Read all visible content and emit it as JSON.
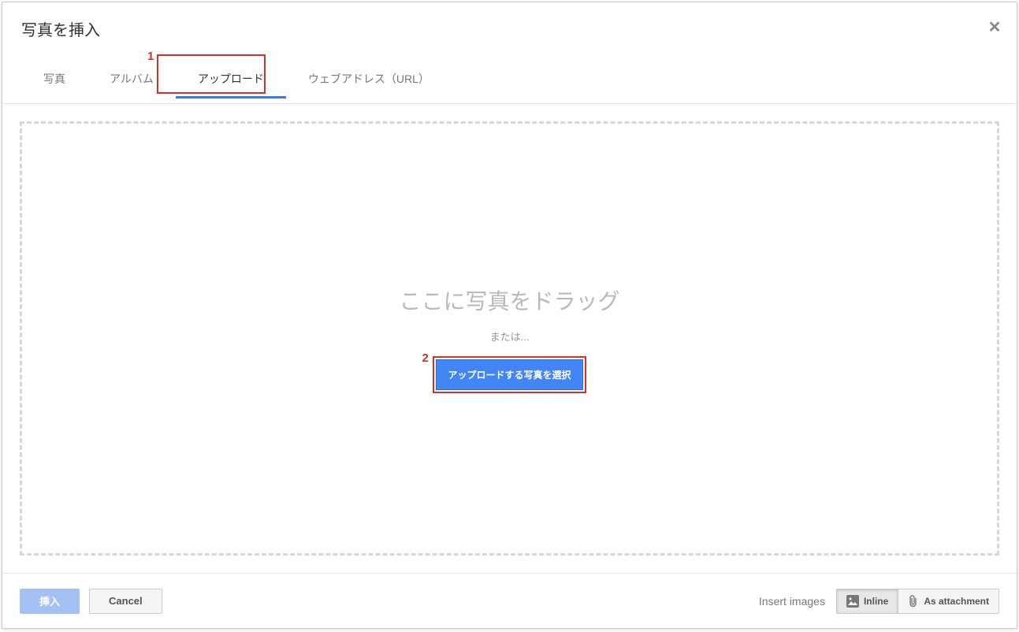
{
  "title": "写真を挿入",
  "tabs": {
    "photos": "写真",
    "albums": "アルバム",
    "upload": "アップロード",
    "url": "ウェブアドレス（URL）"
  },
  "dropzone": {
    "drag_text": "ここに写真をドラッグ",
    "or_text": "または...",
    "select_button": "アップロードする写真を選択"
  },
  "footer": {
    "insert": "挿入",
    "cancel": "Cancel",
    "insert_images_label": "Insert images",
    "inline": "Inline",
    "as_attachment": "As attachment"
  },
  "annotations": {
    "num1": "1",
    "num2": "2"
  }
}
